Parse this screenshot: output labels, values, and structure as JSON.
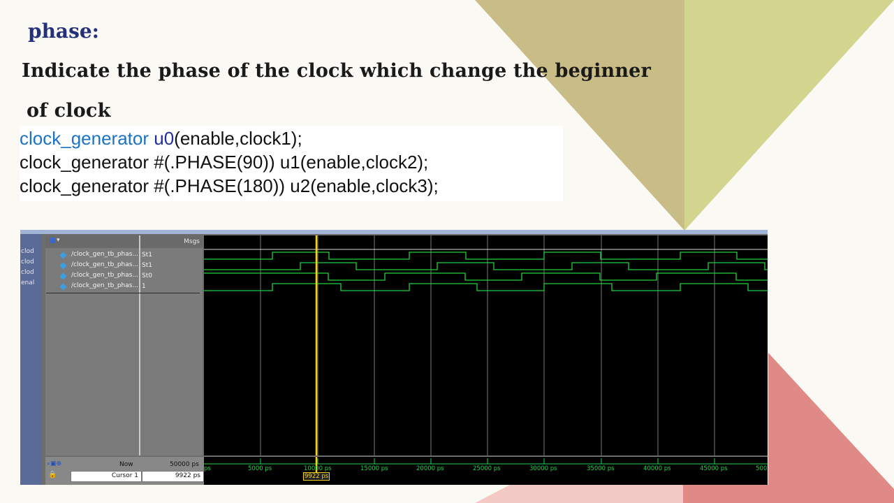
{
  "slide": {
    "title": "phase:",
    "subtitle_line1": "Indicate the phase of the clock  which change the beginner",
    "subtitle_line2": "of clock",
    "colors": {
      "olive": "#c9bd87",
      "lime": "#d3d58f",
      "rose": "#e08a87",
      "pink": "#f3c9c6",
      "title_blue": "#23307a"
    }
  },
  "code": {
    "line1": {
      "kw": "clock_generator",
      "id": "u0",
      "rest": "(enable,clock1);"
    },
    "line2": "clock_generator #(.PHASE(90)) u1(enable,clock2);",
    "line3": "clock_generator #(.PHASE(180)) u2(enable,clock3);"
  },
  "waveform": {
    "msgs_header": "Msgs",
    "left_nav": [
      "clod",
      "clod",
      "clod",
      "enal"
    ],
    "signals": [
      {
        "name": "/clock_gen_tb_phas...",
        "value": "St1"
      },
      {
        "name": "/clock_gen_tb_phas...",
        "value": "St1"
      },
      {
        "name": "/clock_gen_tb_phas...",
        "value": "St0"
      },
      {
        "name": "/clock_gen_tb_phas...",
        "value": "1"
      }
    ],
    "now_label": "Now",
    "now_value": "50000 ps",
    "cursor_label": "Cursor 1",
    "cursor_value": "9922 ps",
    "cursor_marker": "9922 ps",
    "time_ticks": [
      "ps",
      "5000 ps",
      "10000 ps",
      "15000 ps",
      "20000 ps",
      "25000 ps",
      "30000 ps",
      "35000 ps",
      "40000 ps",
      "45000 ps",
      "500"
    ]
  }
}
